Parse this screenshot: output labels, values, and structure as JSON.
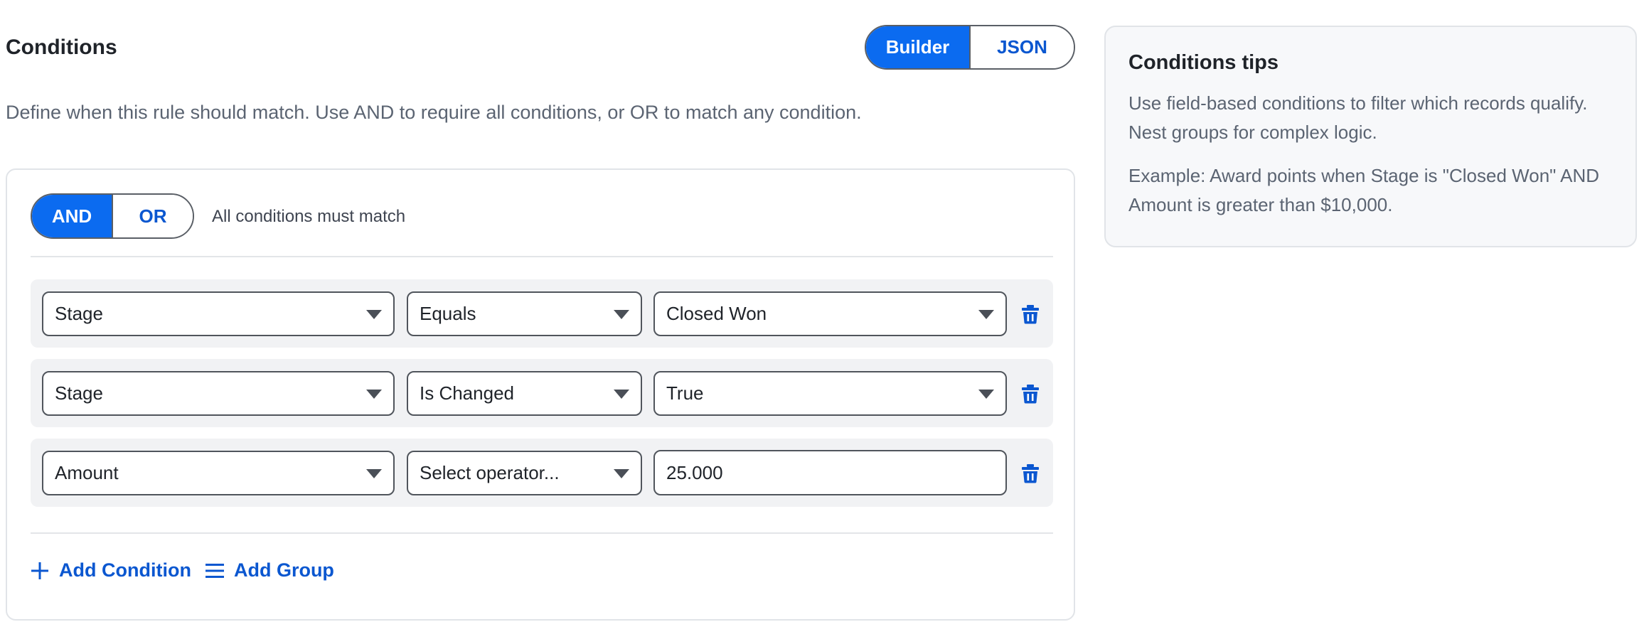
{
  "header": {
    "title": "Conditions",
    "description": "Define when this rule should match. Use AND to require all conditions, or OR to match any condition."
  },
  "mode_toggle": {
    "options": [
      "Builder",
      "JSON"
    ],
    "selected": "Builder"
  },
  "logic": {
    "options": [
      "AND",
      "OR"
    ],
    "selected": "AND",
    "hint": "All conditions must match"
  },
  "conditions": [
    {
      "field": "Stage",
      "operator": "Equals",
      "value": "Closed Won",
      "value_type": "select"
    },
    {
      "field": "Stage",
      "operator": "Is Changed",
      "value": "True",
      "value_type": "select"
    },
    {
      "field": "Amount",
      "operator": "Select operator...",
      "value": "25.000",
      "value_type": "text"
    }
  ],
  "actions": {
    "add_condition": "Add Condition",
    "add_group": "Add Group"
  },
  "tips": {
    "title": "Conditions tips",
    "paragraph_1": "Use field-based conditions to filter which records qualify. Nest groups for complex logic.",
    "paragraph_2": "Example: Award points when Stage is \"Closed Won\" AND Amount is greater than $10,000."
  },
  "icons": {
    "delete": "trash-icon",
    "add_condition": "plus-icon",
    "add_group": "list-icon",
    "dropdown": "chevron-down-icon"
  },
  "colors": {
    "accent": "#0b6bf0",
    "link": "#0b57d0",
    "muted_text": "#5b6472",
    "row_background": "#f1f2f4",
    "tips_background": "#f7f8fa"
  }
}
